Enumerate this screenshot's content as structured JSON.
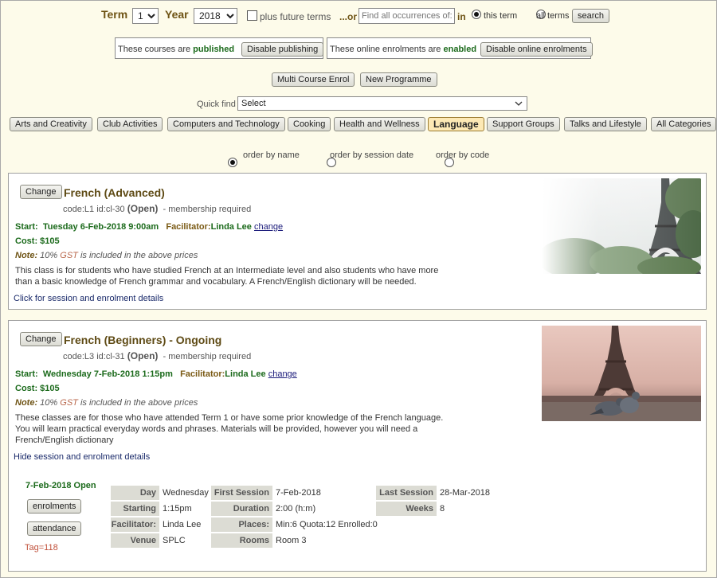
{
  "topbar": {
    "term_label": "Term",
    "term_value": "1",
    "year_label": "Year",
    "year_value": "2018",
    "future_terms": "plus future terms",
    "or_label": "...or",
    "find_placeholder": "Find all occurrences of:",
    "in_label": "in",
    "this_term": "this term",
    "all_terms": "all terms",
    "search_button": "search"
  },
  "publish": {
    "text_prefix": "These courses are",
    "state": "published",
    "button": "Disable publishing"
  },
  "online": {
    "text_prefix": "These online enrolments are",
    "state": "enabled",
    "button": "Disable online enrolments"
  },
  "actions": {
    "multi": "Multi Course Enrol",
    "new_programme": "New Programme"
  },
  "quickfind": {
    "label": "Quick find",
    "value": "Select"
  },
  "categories": [
    {
      "label": "Arts and Creativity"
    },
    {
      "label": "Club Activities"
    },
    {
      "label": "Computers and Technology"
    },
    {
      "label": "Cooking"
    },
    {
      "label": "Health and Wellness"
    },
    {
      "label": "Language"
    },
    {
      "label": "Support Groups"
    },
    {
      "label": "Talks and Lifestyle"
    },
    {
      "label": "All Categories"
    }
  ],
  "order": {
    "by_name": "order by name",
    "by_date": "order by session date",
    "by_code": "order by code"
  },
  "courses": [
    {
      "change_button": "Change",
      "title": "French (Advanced)",
      "code": "code:L1 id:cl-30",
      "status": "(Open)",
      "membership": "- membership required",
      "start_label": "Start:",
      "start_value": "Tuesday 6-Feb-2018 9:00am",
      "facilitator_label": "Facilitator:",
      "facilitator_value": "Linda Lee",
      "change_link": "change",
      "cost": "Cost: $105",
      "note_label": "Note:",
      "note_pct": "10%",
      "note_gst": "GST",
      "note_rest": "is included in the above prices",
      "desc": [
        "This class is for students who have studied French at an Intermediate level and also students who have more",
        "than a basic knowledge of French grammar and vocabulary. A French/English dictionary will be needed."
      ],
      "details_link": "Click for session and enrolment details"
    },
    {
      "change_button": "Change",
      "title": "French (Beginners) - Ongoing",
      "code": "code:L3 id:cl-31",
      "status": "(Open)",
      "membership": "- membership required",
      "start_label": "Start:",
      "start_value": "Wednesday 7-Feb-2018 1:15pm",
      "facilitator_label": "Facilitator:",
      "facilitator_value": "Linda Lee",
      "change_link": "change",
      "cost": "Cost: $105",
      "note_label": "Note:",
      "note_pct": "10%",
      "note_gst": "GST",
      "note_rest": "is included in the above prices",
      "desc": [
        "These classes are for those who have attended Term 1 or have some prior knowledge of the French language.",
        "You will learn practical everyday words and phrases. Materials will be provided, however you will need a",
        "French/English dictionary"
      ],
      "details_link": "Hide session and enrolment details",
      "session": {
        "date_status": "7-Feb-2018 Open",
        "enrolments_button": "enrolments",
        "attendance_button": "attendance",
        "tag": "Tag=118",
        "day_label": "Day",
        "day_value": "Wednesday",
        "starting_label": "Starting",
        "starting_value": "1:15pm",
        "facilitator_label": "Facilitator:",
        "facilitator_value": "Linda Lee",
        "venue_label": "Venue",
        "venue_value": "SPLC",
        "first_label": "First Session",
        "first_value": "7-Feb-2018",
        "duration_label": "Duration",
        "duration_value": "2:00 (h:m)",
        "places_label": "Places:",
        "places_value": "Min:6 Quota:12 Enrolled:0",
        "rooms_label": "Rooms",
        "rooms_value": "Room 3",
        "last_label": "Last Session",
        "last_value": "28-Mar-2018",
        "weeks_label": "Weeks",
        "weeks_value": "8"
      }
    }
  ]
}
